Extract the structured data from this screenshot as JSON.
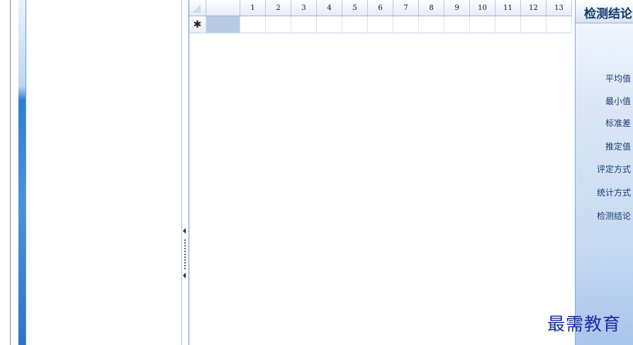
{
  "grid": {
    "columns": [
      "1",
      "2",
      "3",
      "4",
      "5",
      "6",
      "7",
      "8",
      "9",
      "10",
      "11",
      "12",
      "13"
    ],
    "new_row_marker": "✱"
  },
  "results_panel": {
    "title": "检测结论",
    "labels": [
      "平均值",
      "最小值",
      "标准差",
      "推定值",
      "评定方式",
      "统计方式",
      "检测结论"
    ]
  },
  "watermark": "最需教育",
  "colors": {
    "accent": "#2f7fd0",
    "selection": "#b7cbe4",
    "panel_title": "#173a6b",
    "watermark": "#1a2aa8"
  }
}
